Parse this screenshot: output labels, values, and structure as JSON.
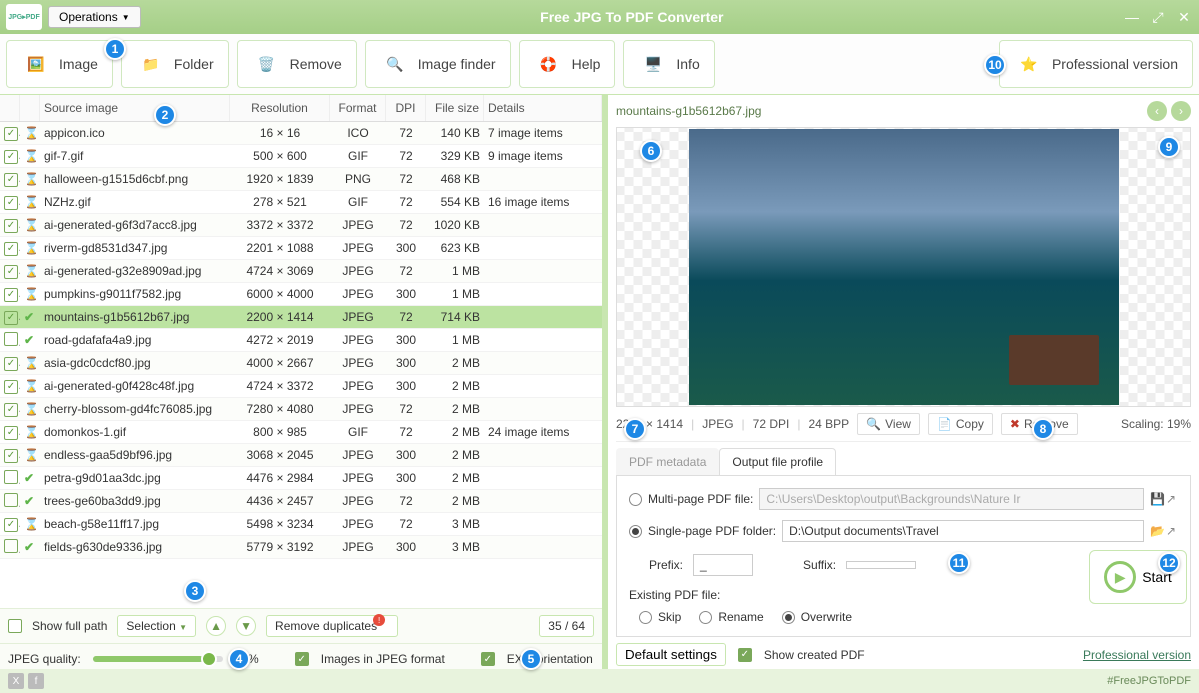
{
  "app": {
    "title": "Free JPG To PDF Converter",
    "operations": "Operations"
  },
  "toolbar": {
    "image": "Image",
    "folder": "Folder",
    "remove": "Remove",
    "finder": "Image finder",
    "help": "Help",
    "info": "Info",
    "pro": "Professional version"
  },
  "columns": {
    "source": "Source image",
    "resolution": "Resolution",
    "format": "Format",
    "dpi": "DPI",
    "filesize": "File size",
    "details": "Details"
  },
  "files": [
    {
      "chk": true,
      "st": "wait",
      "name": "appicon.ico",
      "res": "16 × 16",
      "fmt": "ICO",
      "dpi": "72",
      "size": "140 KB",
      "det": "7 image items"
    },
    {
      "chk": true,
      "st": "wait",
      "name": "gif-7.gif",
      "res": "500 × 600",
      "fmt": "GIF",
      "dpi": "72",
      "size": "329 KB",
      "det": "9 image items"
    },
    {
      "chk": true,
      "st": "wait",
      "name": "halloween-g1515d6cbf.png",
      "res": "1920 × 1839",
      "fmt": "PNG",
      "dpi": "72",
      "size": "468 KB",
      "det": ""
    },
    {
      "chk": true,
      "st": "wait",
      "name": "NZHz.gif",
      "res": "278 × 521",
      "fmt": "GIF",
      "dpi": "72",
      "size": "554 KB",
      "det": "16 image items"
    },
    {
      "chk": true,
      "st": "wait",
      "name": "ai-generated-g6f3d7acc8.jpg",
      "res": "3372 × 3372",
      "fmt": "JPEG",
      "dpi": "72",
      "size": "1020 KB",
      "det": ""
    },
    {
      "chk": true,
      "st": "wait",
      "name": "riverm-gd8531d347.jpg",
      "res": "2201 × 1088",
      "fmt": "JPEG",
      "dpi": "300",
      "size": "623 KB",
      "det": ""
    },
    {
      "chk": true,
      "st": "wait",
      "name": "ai-generated-g32e8909ad.jpg",
      "res": "4724 × 3069",
      "fmt": "JPEG",
      "dpi": "72",
      "size": "1 MB",
      "det": ""
    },
    {
      "chk": true,
      "st": "wait",
      "name": "pumpkins-g9011f7582.jpg",
      "res": "6000 × 4000",
      "fmt": "JPEG",
      "dpi": "300",
      "size": "1 MB",
      "det": ""
    },
    {
      "chk": true,
      "st": "done",
      "name": "mountains-g1b5612b67.jpg",
      "res": "2200 × 1414",
      "fmt": "JPEG",
      "dpi": "72",
      "size": "714 KB",
      "det": "",
      "sel": true
    },
    {
      "chk": false,
      "st": "done",
      "name": "road-gdafafa4a9.jpg",
      "res": "4272 × 2019",
      "fmt": "JPEG",
      "dpi": "300",
      "size": "1 MB",
      "det": ""
    },
    {
      "chk": true,
      "st": "wait",
      "name": "asia-gdc0cdcf80.jpg",
      "res": "4000 × 2667",
      "fmt": "JPEG",
      "dpi": "300",
      "size": "2 MB",
      "det": ""
    },
    {
      "chk": true,
      "st": "wait",
      "name": "ai-generated-g0f428c48f.jpg",
      "res": "4724 × 3372",
      "fmt": "JPEG",
      "dpi": "300",
      "size": "2 MB",
      "det": ""
    },
    {
      "chk": true,
      "st": "wait",
      "name": "cherry-blossom-gd4fc76085.jpg",
      "res": "7280 × 4080",
      "fmt": "JPEG",
      "dpi": "72",
      "size": "2 MB",
      "det": ""
    },
    {
      "chk": true,
      "st": "wait",
      "name": "domonkos-1.gif",
      "res": "800 × 985",
      "fmt": "GIF",
      "dpi": "72",
      "size": "2 MB",
      "det": "24 image items"
    },
    {
      "chk": true,
      "st": "wait",
      "name": "endless-gaa5d9bf96.jpg",
      "res": "3068 × 2045",
      "fmt": "JPEG",
      "dpi": "300",
      "size": "2 MB",
      "det": ""
    },
    {
      "chk": false,
      "st": "done",
      "name": "petra-g9d01aa3dc.jpg",
      "res": "4476 × 2984",
      "fmt": "JPEG",
      "dpi": "300",
      "size": "2 MB",
      "det": ""
    },
    {
      "chk": false,
      "st": "done",
      "name": "trees-ge60ba3dd9.jpg",
      "res": "4436 × 2457",
      "fmt": "JPEG",
      "dpi": "72",
      "size": "2 MB",
      "det": ""
    },
    {
      "chk": true,
      "st": "wait",
      "name": "beach-g58e11ff17.jpg",
      "res": "5498 × 3234",
      "fmt": "JPEG",
      "dpi": "72",
      "size": "3 MB",
      "det": ""
    },
    {
      "chk": false,
      "st": "done",
      "name": "fields-g630de9336.jpg",
      "res": "5779 × 3192",
      "fmt": "JPEG",
      "dpi": "300",
      "size": "3 MB",
      "det": ""
    }
  ],
  "bottom": {
    "showfull": "Show full path",
    "selection": "Selection",
    "dupes": "Remove duplicates",
    "count": "35 / 64",
    "quality_label": "JPEG quality:",
    "quality_val": "88%",
    "jpeg_fmt": "Images in JPEG format",
    "exif": "EXIF orientation"
  },
  "preview": {
    "filename": "mountains-g1b5612b67.jpg",
    "res": "2200 × 1414",
    "fmt": "JPEG",
    "dpi": "72 DPI",
    "bpp": "24 BPP",
    "view": "View",
    "copy": "Copy",
    "remove": "Remove",
    "scaling": "Scaling: 19%"
  },
  "tabs": {
    "meta": "PDF metadata",
    "profile": "Output file profile"
  },
  "output": {
    "multi_label": "Multi-page PDF file:",
    "multi_path": "C:\\Users\\Desktop\\output\\Backgrounds\\Nature Ir",
    "single_label": "Single-page PDF folder:",
    "single_path": "D:\\Output documents\\Travel",
    "prefix_label": "Prefix:",
    "prefix_val": "_",
    "suffix_label": "Suffix:",
    "suffix_val": "",
    "existing_label": "Existing PDF file:",
    "skip": "Skip",
    "rename": "Rename",
    "overwrite": "Overwrite"
  },
  "actions": {
    "defaults": "Default settings",
    "showpdf": "Show created PDF",
    "start": "Start",
    "prolink": "Professional version"
  },
  "footer": {
    "hashtag": "#FreeJPGToPDF"
  },
  "badges": [
    "1",
    "2",
    "3",
    "4",
    "5",
    "6",
    "7",
    "8",
    "9",
    "10",
    "11",
    "12"
  ]
}
